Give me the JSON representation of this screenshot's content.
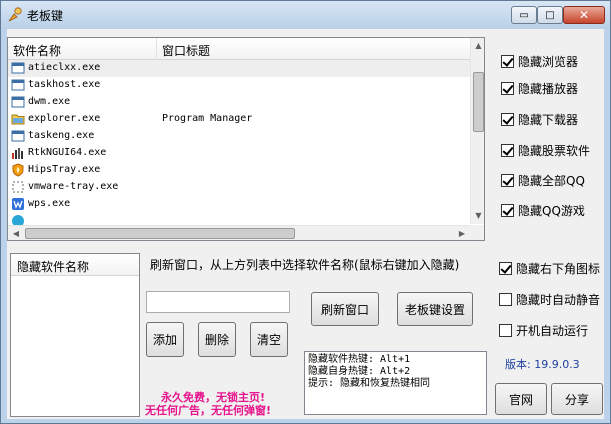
{
  "window": {
    "title": "老板键",
    "close_glyph": "✕",
    "minimize_glyph": "▭",
    "maximize_glyph": "□"
  },
  "process_list": {
    "columns": [
      "软件名称",
      "窗口标题"
    ],
    "rows": [
      {
        "name": "atieclxx.exe",
        "title": "",
        "icon": "app-window-icon"
      },
      {
        "name": "taskhost.exe",
        "title": "",
        "icon": "app-window-icon"
      },
      {
        "name": "dwm.exe",
        "title": "",
        "icon": "app-window-icon"
      },
      {
        "name": "explorer.exe",
        "title": "Program Manager",
        "icon": "folder-icon"
      },
      {
        "name": "taskeng.exe",
        "title": "",
        "icon": "app-window-icon"
      },
      {
        "name": "RtkNGUI64.exe",
        "title": "",
        "icon": "audio-icon"
      },
      {
        "name": "HipsTray.exe",
        "title": "",
        "icon": "shield-flame-icon"
      },
      {
        "name": "vmware-tray.exe",
        "title": "",
        "icon": "vmware-icon"
      },
      {
        "name": "wps.exe",
        "title": "",
        "icon": "wps-icon"
      },
      {
        "name": "",
        "title": "",
        "icon": "app-window-icon"
      }
    ]
  },
  "options": [
    {
      "label": "隐藏浏览器",
      "checked": true
    },
    {
      "label": "隐藏播放器",
      "checked": true
    },
    {
      "label": "隐藏下载器",
      "checked": true
    },
    {
      "label": "隐藏股票软件",
      "checked": true
    },
    {
      "label": "隐藏全部QQ",
      "checked": true
    },
    {
      "label": "隐藏QQ游戏",
      "checked": true
    }
  ],
  "hidden_list": {
    "header": "隐藏软件名称"
  },
  "instruction": "刷新窗口，从上方列表中选择软件名称(鼠标右键加入隐藏)",
  "buttons": {
    "add": "添加",
    "delete": "删除",
    "clear": "清空",
    "refresh": "刷新窗口",
    "settings": "老板键设置",
    "official": "官网",
    "share": "分享"
  },
  "search_input": {
    "value": ""
  },
  "promo": {
    "line1": "永久免费，无锁主页!",
    "line2": "无任何广告，无任何弹窗!"
  },
  "hotkeys": [
    "隐藏软件热键: Alt+1",
    "隐藏自身热键: Alt+2",
    "提示: 隐藏和恢复热键相同"
  ],
  "settings": [
    {
      "label": "隐藏右下角图标",
      "checked": true
    },
    {
      "label": "隐藏时自动静音",
      "checked": false
    },
    {
      "label": "开机自动运行",
      "checked": false
    }
  ],
  "version": "版本: 19.9.0.3"
}
